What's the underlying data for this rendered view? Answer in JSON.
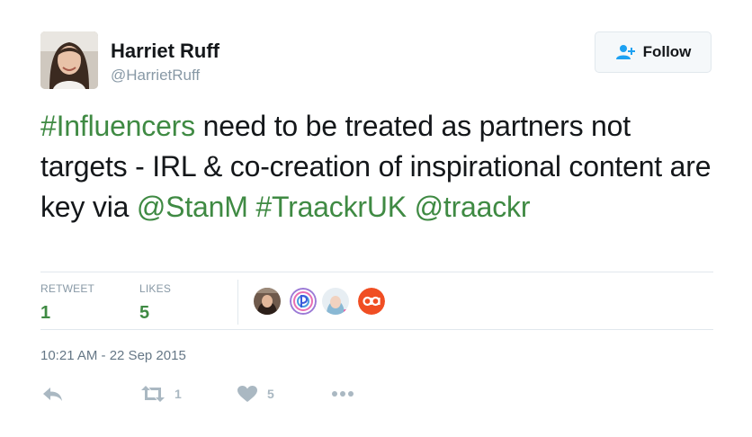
{
  "author": {
    "name": "Harriet Ruff",
    "handle": "@HarrietRuff"
  },
  "follow_button": {
    "label": "Follow",
    "icon": "add-user-icon"
  },
  "tweet": {
    "segments": [
      {
        "text": "#Influencers",
        "type": "hashtag"
      },
      {
        "text": " need to be treated as partners not targets - IRL & co-creation of inspirational content are key via ",
        "type": "text"
      },
      {
        "text": "@StanM",
        "type": "mention"
      },
      {
        "text": " ",
        "type": "text"
      },
      {
        "text": "#TraackrUK",
        "type": "hashtag"
      },
      {
        "text": " ",
        "type": "text"
      },
      {
        "text": "@traackr",
        "type": "mention"
      }
    ]
  },
  "stats": {
    "retweets": {
      "label": "RETWEET",
      "value": "1"
    },
    "likes": {
      "label": "LIKES",
      "value": "5"
    }
  },
  "likers": [
    "avatar-1",
    "pinterest-style-logo",
    "avatar-3",
    "aa-logo"
  ],
  "timestamp": "10:21 AM - 22 Sep 2015",
  "actions": {
    "reply": {
      "icon": "reply-icon"
    },
    "retweet": {
      "icon": "retweet-icon",
      "count": "1"
    },
    "like": {
      "icon": "heart-icon",
      "count": "5"
    },
    "more": {
      "icon": "more-icon"
    }
  },
  "colors": {
    "link": "#3f8a43",
    "muted": "#8899a6",
    "action": "#aab8c2"
  }
}
